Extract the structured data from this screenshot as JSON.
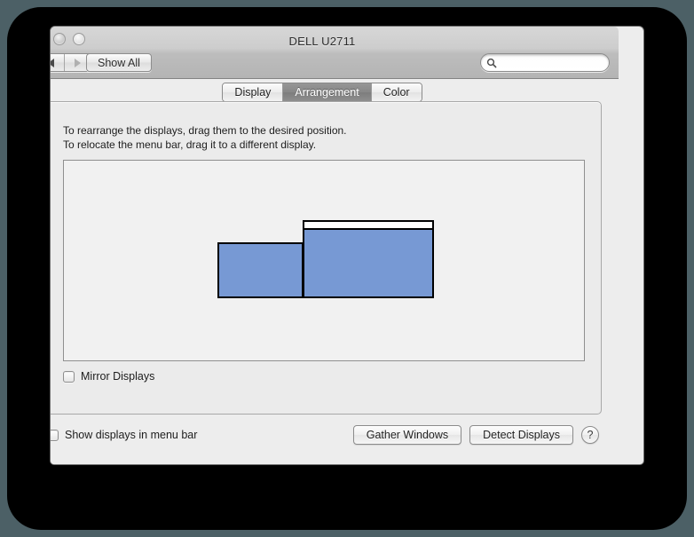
{
  "window": {
    "title": "DELL U2711",
    "traffic_lights": [
      "close-button",
      "minimize-button",
      "zoom-button"
    ]
  },
  "toolbar": {
    "back_label": "◀",
    "forward_label": "▶",
    "show_all_label": "Show All",
    "search": {
      "value": "",
      "placeholder": "",
      "icon": "search-icon"
    }
  },
  "tabs": [
    {
      "label": "Display",
      "selected": false
    },
    {
      "label": "Arrangement",
      "selected": true
    },
    {
      "label": "Color",
      "selected": false
    }
  ],
  "arrangement": {
    "instructions_line1": "To rearrange the displays, drag them to the desired position.",
    "instructions_line2": "To relocate the menu bar, drag it to a different display.",
    "displays": [
      {
        "name": "display-left",
        "has_menu_bar": false
      },
      {
        "name": "display-right",
        "has_menu_bar": true
      }
    ],
    "mirror_displays": {
      "label": "Mirror Displays",
      "checked": false
    }
  },
  "bottom": {
    "show_in_menu_bar": {
      "label": "Show displays in menu bar",
      "checked": false
    },
    "gather_windows_label": "Gather Windows",
    "detect_displays_label": "Detect Displays",
    "help_label": "?"
  },
  "colors": {
    "display_fill": "#7799d4",
    "display_border": "#000000",
    "menu_bar": "#ffffff",
    "selected_tab_text": "#ffffff",
    "window_background": "#ededed"
  }
}
